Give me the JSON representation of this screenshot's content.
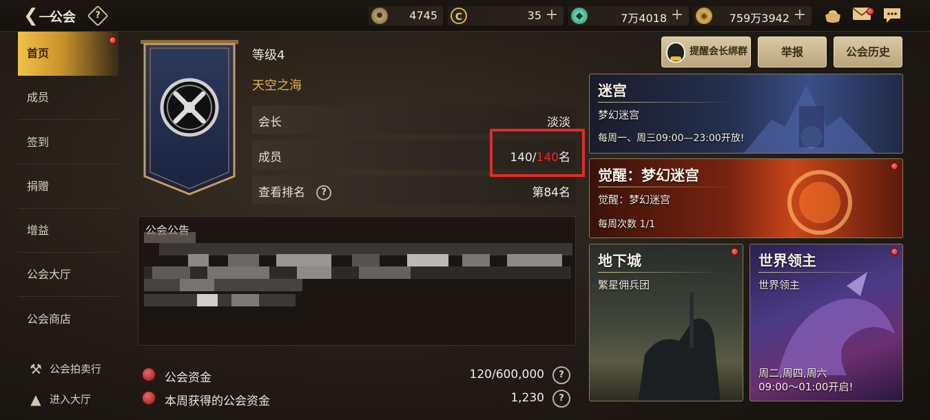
{
  "topbar": {
    "title": "公会",
    "help_glyph": "?",
    "currencies": [
      {
        "icon": "gear-coin-icon",
        "value": "4745",
        "has_plus": false
      },
      {
        "icon": "c-coin-icon",
        "value": "35",
        "has_plus": true
      },
      {
        "icon": "gem-icon",
        "value": "7万4018",
        "has_plus": true
      },
      {
        "icon": "gold-coin-icon",
        "value": "759万3942",
        "has_plus": true
      }
    ],
    "plus_glyph": "+"
  },
  "sidebar": {
    "items": [
      {
        "label": "首页",
        "active": true
      },
      {
        "label": "成员"
      },
      {
        "label": "签到"
      },
      {
        "label": "捐赠"
      },
      {
        "label": "增益"
      },
      {
        "label": "公会大厅"
      },
      {
        "label": "公会商店"
      }
    ],
    "sub_items": [
      {
        "label": "公会拍卖行"
      },
      {
        "label": "进入大厅"
      }
    ]
  },
  "guild": {
    "level": "等级4",
    "name": "天空之海",
    "leader_label": "会长",
    "leader_value": "淡淡",
    "members_label": "成员",
    "members_current": "140/",
    "members_max": "140",
    "members_unit": "名",
    "rank_label": "查看排名",
    "rank_value": "第84名"
  },
  "announcement": {
    "title": "公会公告"
  },
  "funds": {
    "fund_label": "公会资金",
    "fund_value": "120/600,000",
    "weekly_label": "本周获得的公会资金",
    "weekly_value": "1,230"
  },
  "buttons": {
    "remind": "提醒会长绑群",
    "report": "举报",
    "history": "公会历史"
  },
  "cards": {
    "maze": {
      "title": "迷宫",
      "sub": "梦幻迷宫",
      "desc": "每周一、周三09:00—23:00开放!"
    },
    "awaken": {
      "title": "觉醒：梦幻迷宫",
      "sub": "觉醒：梦幻迷宫",
      "desc": "每周次数 1/1"
    },
    "dungeon": {
      "title": "地下城",
      "sub": "繁星佣兵团"
    },
    "boss": {
      "title": "世界领主",
      "sub": "世界领主",
      "desc1": "周二,周四,周六",
      "desc2": "09:00～01:00开启!"
    }
  },
  "colors": {
    "accent_gold": "#e3b04f",
    "highlight_red": "#e02b2b",
    "member_max_red": "#e82727"
  }
}
